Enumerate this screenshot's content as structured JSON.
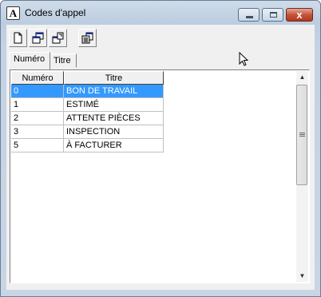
{
  "window": {
    "title": "Codes d'appel",
    "app_icon_letter": "A",
    "close_glyph": "x"
  },
  "toolbar": {
    "buttons": [
      "new-document-icon",
      "copy-windows-icon",
      "export-icon",
      "properties-icon"
    ]
  },
  "tabs": [
    {
      "label": "Numéro",
      "active": true
    },
    {
      "label": "Titre",
      "active": false
    }
  ],
  "grid": {
    "columns": [
      "Numéro",
      "Titre"
    ],
    "rows": [
      {
        "num": "0",
        "title": "BON DE TRAVAIL",
        "selected": true
      },
      {
        "num": "1",
        "title": "ESTIMÉ",
        "selected": false
      },
      {
        "num": "2",
        "title": "ATTENTE PIÈCES",
        "selected": false
      },
      {
        "num": "3",
        "title": "INSPECTION",
        "selected": false
      },
      {
        "num": "5",
        "title": "À FACTURER",
        "selected": false
      }
    ]
  },
  "colors": {
    "selection": "#3399ff",
    "close_button": "#c4553c"
  }
}
